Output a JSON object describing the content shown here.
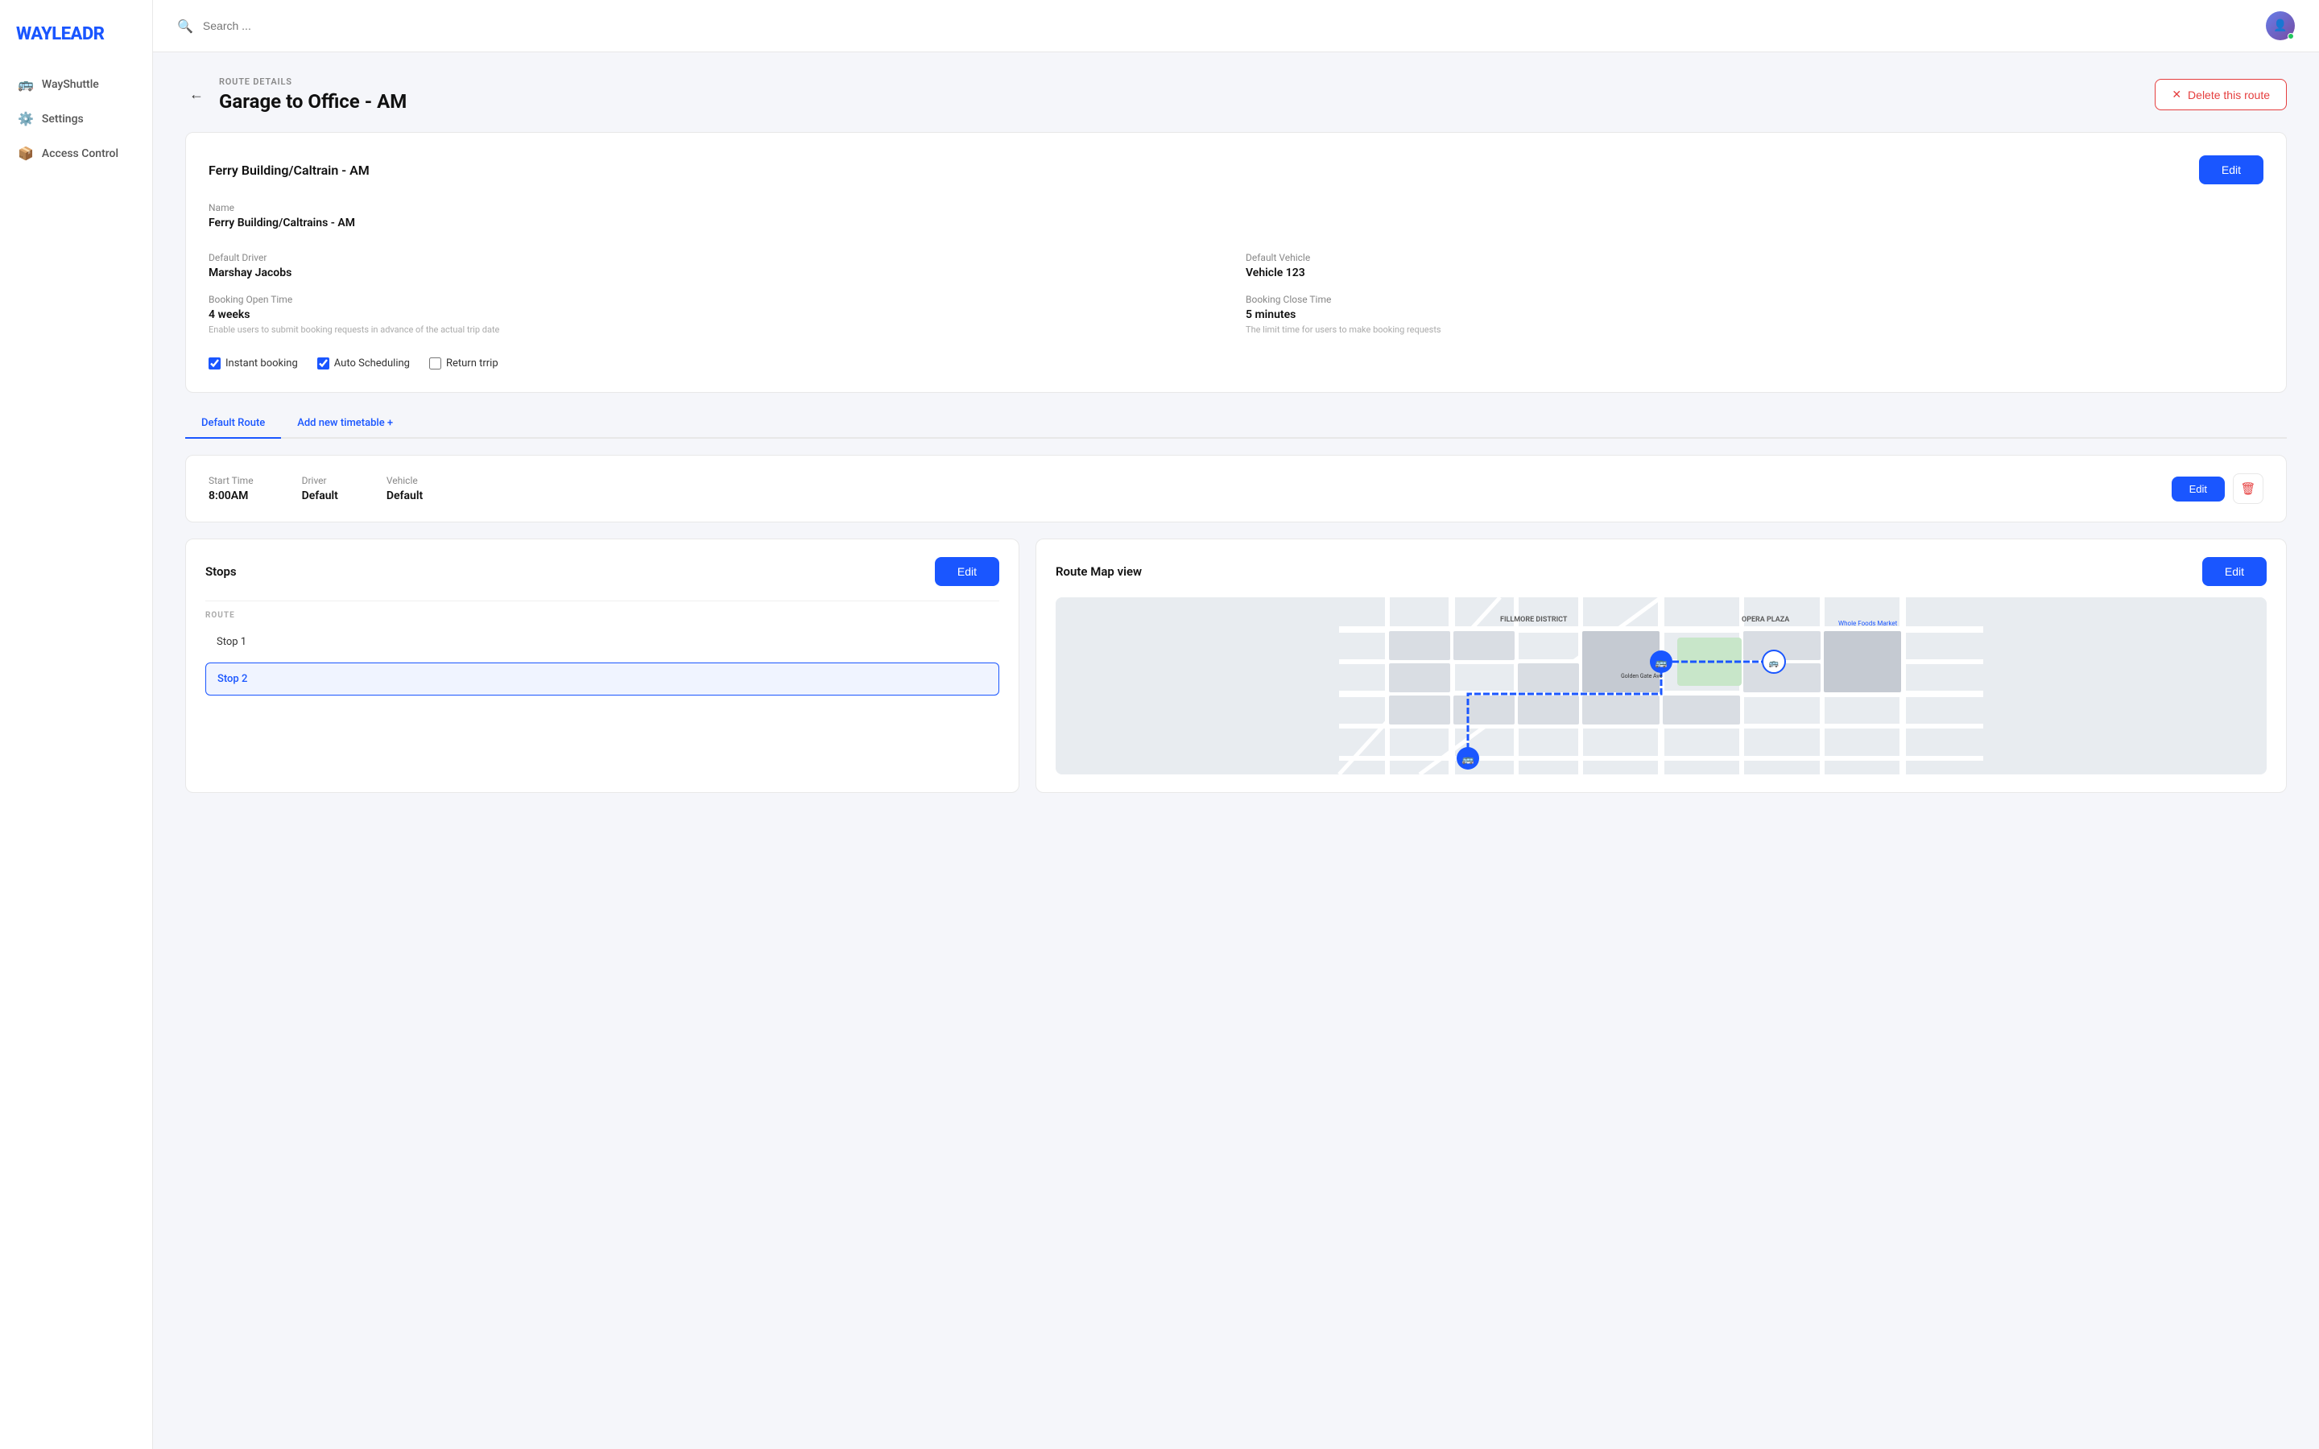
{
  "sidebar": {
    "logo": "WAYLEADR",
    "nav_items": [
      {
        "id": "wayshuttle",
        "label": "WayShuttle",
        "icon": "🚌"
      },
      {
        "id": "settings",
        "label": "Settings",
        "icon": "⚙️"
      },
      {
        "id": "access-control",
        "label": "Access Control",
        "icon": "📦"
      }
    ]
  },
  "header": {
    "search_placeholder": "Search ...",
    "avatar_initials": "U"
  },
  "page": {
    "breadcrumb": "ROUTE DETAILS",
    "title": "Garage to Office - AM",
    "delete_button": "Delete this route"
  },
  "route_card": {
    "title": "Ferry Building/Caltrain - AM",
    "edit_label": "Edit",
    "name_label": "Name",
    "name_value": "Ferry Building/Caltrains - AM",
    "default_driver_label": "Default Driver",
    "default_driver_value": "Marshay Jacobs",
    "default_vehicle_label": "Default Vehicle",
    "default_vehicle_value": "Vehicle 123",
    "booking_open_label": "Booking Open Time",
    "booking_open_value": "4 weeks",
    "booking_open_hint": "Enable users to submit booking requests in advance of the actual trip date",
    "booking_close_label": "Booking Close Time",
    "booking_close_value": "5 minutes",
    "booking_close_hint": "The limit time for users to make booking requests",
    "instant_booking_label": "Instant booking",
    "instant_booking_checked": true,
    "auto_scheduling_label": "Auto Scheduling",
    "auto_scheduling_checked": true,
    "return_trip_label": "Return trrip",
    "return_trip_checked": false
  },
  "tabs": [
    {
      "id": "default-route",
      "label": "Default Route",
      "active": true
    },
    {
      "id": "add-timetable",
      "label": "Add new timetable +",
      "active": false
    }
  ],
  "timetable": {
    "start_time_label": "Start Time",
    "start_time_value": "8:00AM",
    "driver_label": "Driver",
    "driver_value": "Default",
    "vehicle_label": "Vehicle",
    "vehicle_value": "Default",
    "edit_label": "Edit"
  },
  "stops_card": {
    "title": "Stops",
    "edit_label": "Edit",
    "route_label": "ROUTE",
    "stops": [
      {
        "id": 1,
        "label": "Stop 1",
        "selected": false
      },
      {
        "id": 2,
        "label": "Stop 2",
        "selected": true
      }
    ]
  },
  "map_card": {
    "title": "Route Map view",
    "edit_label": "Edit"
  }
}
